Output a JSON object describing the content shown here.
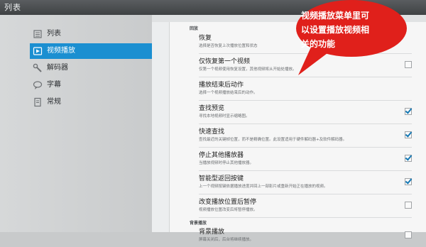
{
  "window": {
    "title": "列表"
  },
  "sidebar": {
    "items": [
      {
        "label": "列表",
        "icon": "list-icon",
        "active": false
      },
      {
        "label": "视频播放",
        "icon": "play-icon",
        "active": true
      },
      {
        "label": "解码器",
        "icon": "wrench-icon",
        "active": false
      },
      {
        "label": "字幕",
        "icon": "speech-bubble-icon",
        "active": false
      },
      {
        "label": "常规",
        "icon": "document-icon",
        "active": false
      }
    ]
  },
  "settings": {
    "sections": [
      {
        "title": "回放"
      },
      {
        "title": "背景播放"
      }
    ],
    "rows": [
      {
        "title": "恢复",
        "desc": "选择是否恢复上次播放位置和状态",
        "checked": null
      },
      {
        "title": "仅恢复第一个视频",
        "desc": "仅第一个视频使用恢复设置，其他视频将从开始处播放。",
        "checked": false
      },
      {
        "title": "播放结束后动作",
        "desc": "选择一个视频播放结束后的动作。",
        "checked": null
      },
      {
        "title": "查找预览",
        "desc": "寻找本地视频时显示缩略图。",
        "checked": true
      },
      {
        "title": "快速查找",
        "desc": "查找最近的关键帧位置，而不是精确位置。此设置适用于硬件解码器+及软件解码器。",
        "checked": true
      },
      {
        "title": "停止其他播放器",
        "desc": "当播放视频时停止其他播放器。",
        "checked": true
      },
      {
        "title": "智能型返回按键",
        "desc": "上一个视频按键依据播放进度并回上一部影片或重新开始正在播放的视频。",
        "checked": true
      },
      {
        "title": "改变播放位置后暂停",
        "desc": "视频播放位置改变后将暂停播放。",
        "checked": false
      },
      {
        "title": "背景播放",
        "desc": "屏幕关闭后，后台将继续播放。",
        "checked": false
      }
    ]
  },
  "callout": {
    "lines": [
      "视频播放菜单里可",
      "以设置播放视频相",
      "关的功能"
    ],
    "color": "#e0201b"
  },
  "colors": {
    "accent": "#1b8fd1",
    "titlebar": "#4a4d50"
  }
}
